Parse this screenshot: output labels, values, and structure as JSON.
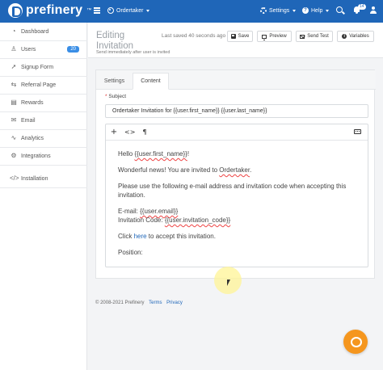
{
  "app": {
    "brand": "prefinery",
    "project": "Ordertaker",
    "nav": {
      "settings": "Settings",
      "help": "Help",
      "notif_count": "14"
    }
  },
  "sidebar": {
    "items": [
      {
        "label": "Dashboard",
        "icon": "dashboard-icon"
      },
      {
        "label": "Users",
        "icon": "users-icon",
        "badge": "20"
      },
      {
        "label": "Signup Form",
        "icon": "signup-form-icon"
      },
      {
        "label": "Referral Page",
        "icon": "referral-page-icon"
      },
      {
        "label": "Rewards",
        "icon": "rewards-icon"
      },
      {
        "label": "Email",
        "icon": "email-icon"
      },
      {
        "label": "Analytics",
        "icon": "analytics-icon"
      },
      {
        "label": "Integrations",
        "icon": "integrations-icon"
      },
      {
        "label": "Installation",
        "icon": "installation-icon"
      }
    ]
  },
  "header": {
    "title": "Editing Invitation",
    "subtitle": "Send immediately after user is invited",
    "saved": "Last saved 40 seconds ago",
    "buttons": {
      "save": "Save",
      "preview": "Preview",
      "send_test": "Send Test",
      "variables": "Variables"
    }
  },
  "tabs": [
    {
      "label": "Settings"
    },
    {
      "label": "Content",
      "active": true
    }
  ],
  "form": {
    "subject_label": "Subject",
    "required_mark": "*",
    "subject_value": "Ordertaker Invitation for {{user.first_name}} {{user.last_name}}"
  },
  "editor": {
    "body": {
      "greeting_prefix": "Hello ",
      "greeting_var": "{{user.first_name}}",
      "greeting_suffix": "!",
      "line2_prefix": "Wonderful news! You are invited to ",
      "line2_name": "Ordertaker",
      "line2_suffix": ".",
      "line3a": "Please use the following e-mail address and invitation code when accepting this",
      "line3b": "invitation.",
      "email_prefix": "E-mail: ",
      "email_var": "{{user.email}}",
      "code_prefix": "Invitation Code: ",
      "code_var": "{{user.invitation_code}}",
      "click_prefix": "Click ",
      "click_link": "here",
      "click_suffix": " to accept this invitation.",
      "position": "Position:"
    }
  },
  "footer": {
    "copyright": "© 2008-2021 Prefinery",
    "terms": "Terms",
    "privacy": "Privacy"
  },
  "colors": {
    "topbar": "#1f66b8",
    "accent": "#3a8ee6",
    "chat": "#f5961e"
  }
}
